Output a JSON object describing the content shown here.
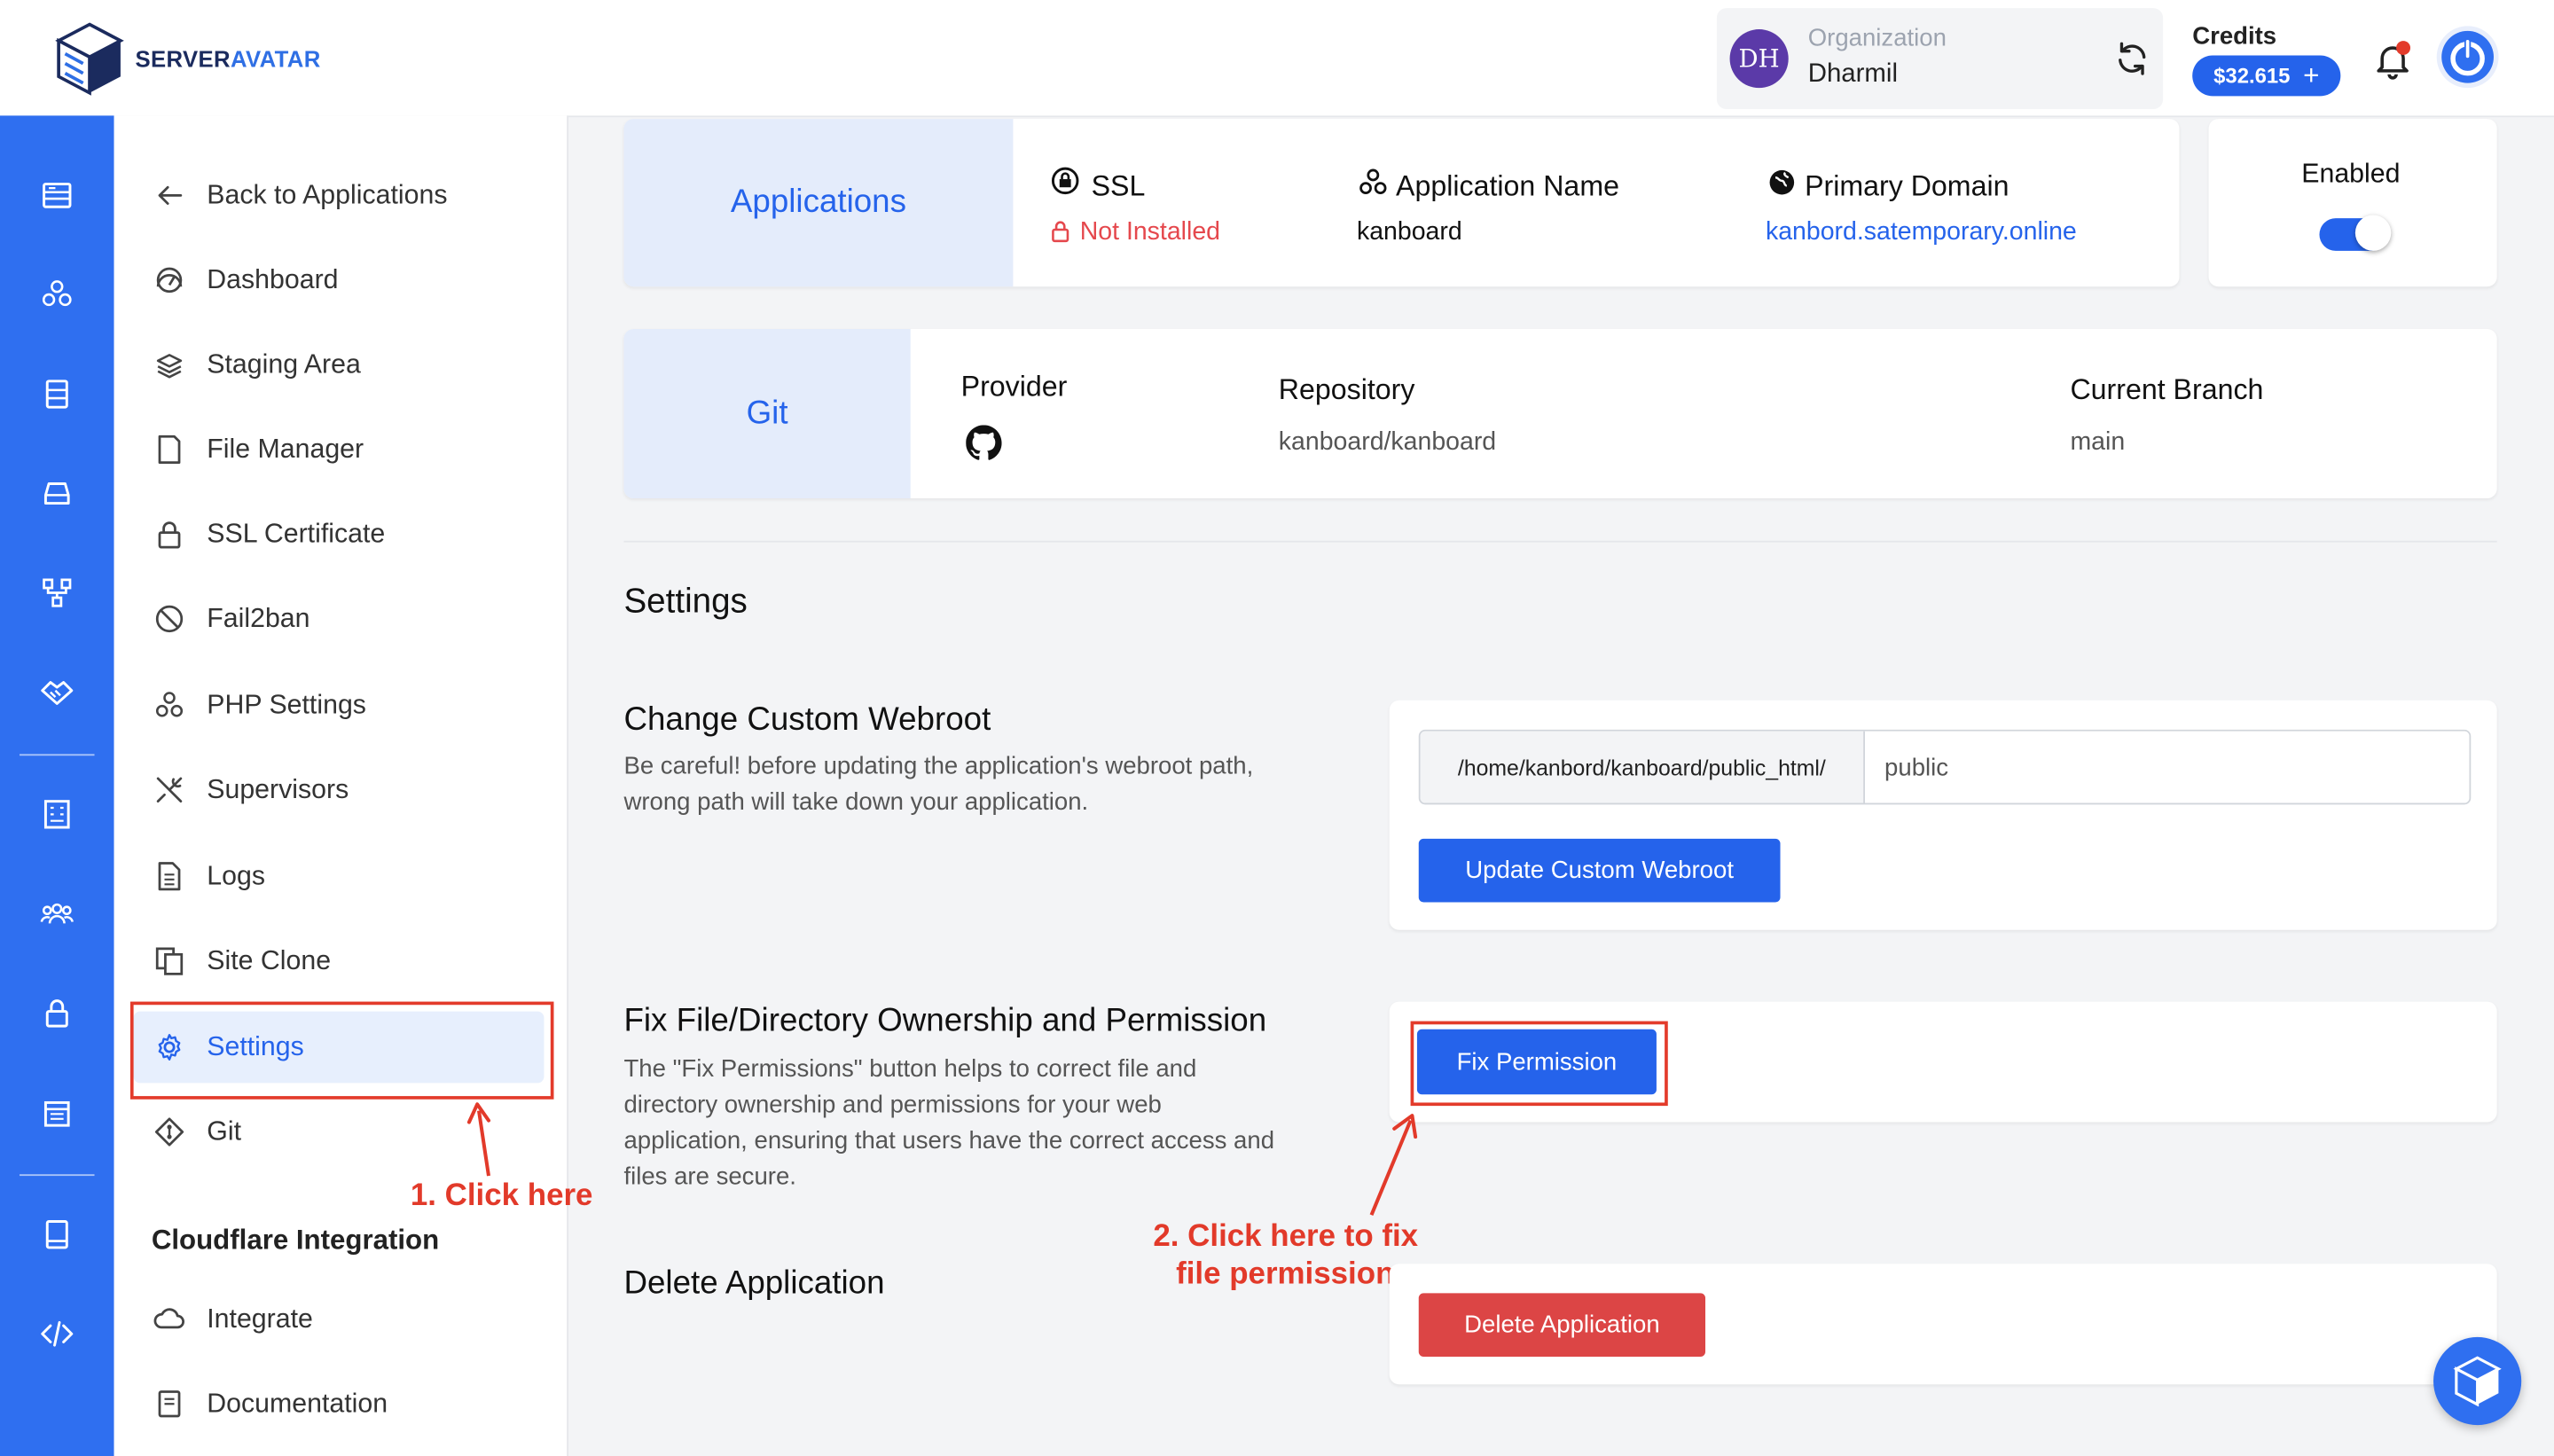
{
  "header": {
    "logo_text_main": "SERVER",
    "logo_text_accent": "AVATAR",
    "org_initials": "DH",
    "org_label": "Organization",
    "org_name": "Dharmil",
    "credits_label": "Credits",
    "credits_value": "$32.615",
    "credits_add": "+"
  },
  "rail": {
    "icons": [
      "servers-icon",
      "applications-icon",
      "databases-icon",
      "storage-icon",
      "workflows-icon",
      "integrations-icon",
      "billing-icon",
      "team-icon",
      "security-icon",
      "calendar-icon",
      "docs-icon",
      "api-icon"
    ]
  },
  "sidebar": {
    "items": [
      {
        "label": "Back to Applications",
        "icon": "arrow-left-icon"
      },
      {
        "label": "Dashboard",
        "icon": "gauge-icon"
      },
      {
        "label": "Staging Area",
        "icon": "layers-icon"
      },
      {
        "label": "File Manager",
        "icon": "file-icon"
      },
      {
        "label": "SSL Certificate",
        "icon": "lock-icon"
      },
      {
        "label": "Fail2ban",
        "icon": "ban-icon"
      },
      {
        "label": "PHP Settings",
        "icon": "cubes-icon"
      },
      {
        "label": "Supervisors",
        "icon": "tools-icon"
      },
      {
        "label": "Logs",
        "icon": "document-icon"
      },
      {
        "label": "Site Clone",
        "icon": "clone-icon"
      },
      {
        "label": "Settings",
        "icon": "gear-icon"
      },
      {
        "label": "Git",
        "icon": "git-icon"
      }
    ],
    "cloudflare_heading": "Cloudflare Integration",
    "cloudflare_items": [
      {
        "label": "Integrate",
        "icon": "cloud-icon"
      },
      {
        "label": "Documentation",
        "icon": "book-icon"
      }
    ]
  },
  "app_card": {
    "tab": "Applications",
    "ssl_label": "SSL",
    "ssl_value": "Not Installed",
    "name_label": "Application Name",
    "name_value": "kanboard",
    "domain_label": "Primary Domain",
    "domain_value": "kanbord.satemporary.online",
    "enabled_label": "Enabled",
    "enabled": true
  },
  "git_card": {
    "tab": "Git",
    "provider_label": "Provider",
    "repo_label": "Repository",
    "repo_value": "kanboard/kanboard",
    "branch_label": "Current Branch",
    "branch_value": "main"
  },
  "settings": {
    "title": "Settings",
    "webroot": {
      "title": "Change Custom Webroot",
      "desc_line1": "Be careful! before updating the application's webroot path,",
      "desc_line2": "wrong path will take down your application.",
      "prefix": "/home/kanbord/kanboard/public_html/",
      "value": "public",
      "button": "Update Custom Webroot"
    },
    "permission": {
      "title": "Fix File/Directory Ownership and Permission",
      "desc_line1": "The \"Fix Permissions\" button helps to correct file and",
      "desc_line2": "directory ownership and permissions for your web",
      "desc_line3": "application, ensuring that users have the correct access and",
      "desc_line4": "files are secure.",
      "button": "Fix Permission"
    },
    "delete": {
      "title": "Delete Application",
      "button": "Delete Application"
    }
  },
  "annotations": {
    "step1": "1. Click here",
    "step2_line1": "2. Click here to fix",
    "step2_line2": "file permission",
    "color": "#e23a2a"
  },
  "colors": {
    "brand": "#2f6ff0",
    "primary_button": "#2563eb",
    "danger_button": "#dc4545",
    "ssl_warning": "#e5484d",
    "active_tab_bg": "#e4ecfb"
  }
}
